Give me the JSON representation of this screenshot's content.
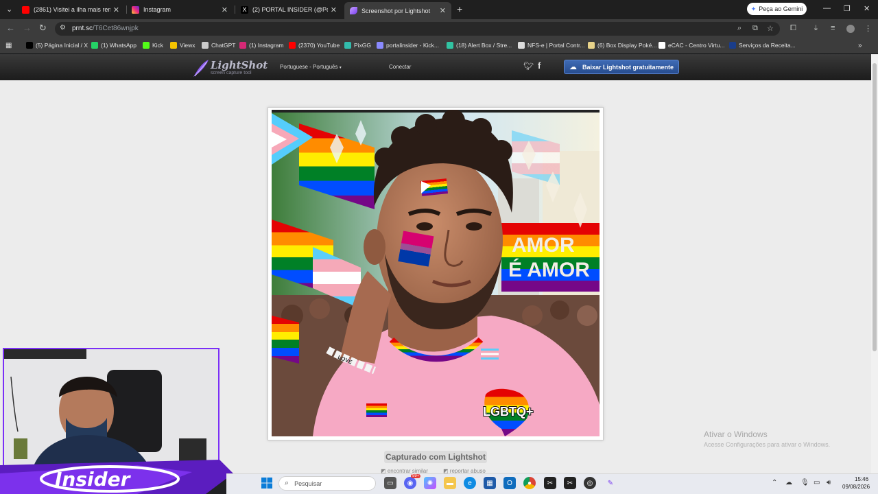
{
  "browser": {
    "tabs": [
      {
        "title": "(2861) Visitei a ilha mais remota",
        "favicon_color": "#ff0000",
        "active": false
      },
      {
        "title": "Instagram",
        "favicon_color": "#d62976",
        "active": false
      },
      {
        "title": "(2) PORTAL INSIDER (@Portal_I",
        "favicon_color": "#000000",
        "active": false
      },
      {
        "title": "Screenshot por Lightshot",
        "favicon_color": "#8a5cf5",
        "active": true
      }
    ],
    "gemini_button": "Peça ao Gemini",
    "url_host": "prnt.sc",
    "url_path": "/T6Cet86wnjpk",
    "bookmarks": [
      {
        "label": "(5) Página Inicial / X",
        "color": "#000000"
      },
      {
        "label": "(1) WhatsApp",
        "color": "#25d366"
      },
      {
        "label": "Kick",
        "color": "#53fc18"
      },
      {
        "label": "Viewx",
        "color": "#f5c400"
      },
      {
        "label": "ChatGPT",
        "color": "#cccccc"
      },
      {
        "label": "(1) Instagram",
        "color": "#d62976"
      },
      {
        "label": "(2370) YouTube",
        "color": "#ff0000"
      },
      {
        "label": "PixGG",
        "color": "#32bcad"
      },
      {
        "label": "portalinsider - Kick...",
        "color": "#8a8aff"
      },
      {
        "label": "(18) Alert Box / Stre...",
        "color": "#31c3a2"
      },
      {
        "label": "NFS-e | Portal Contr...",
        "color": "#dddddd"
      },
      {
        "label": "(6) Box Display Poké...",
        "color": "#e8d38a"
      },
      {
        "label": "eCAC - Centro Virtu...",
        "color": "#ffffff"
      },
      {
        "label": "Serviços da Receita...",
        "color": "#1a3d8a"
      }
    ]
  },
  "lightshot": {
    "logo_name": "LightShot",
    "logo_tagline": "screen capture tool",
    "language": "Portuguese - Português",
    "login": "Conectar",
    "download_button": "Baixar Lightshot gratuitamente",
    "captured_label": "Capturado com Lightshot",
    "find_similar": "encontrar similar",
    "report_abuse": "reportar abuso"
  },
  "screenshot_image": {
    "banner_text_line1": "AMOR",
    "banner_text_line2": "É AMOR",
    "bracelet_text": "LOVE",
    "badge_text": "LGBTQ+"
  },
  "overlay": {
    "brand": "Insider"
  },
  "windows": {
    "watermark_title": "Ativar o Windows",
    "watermark_sub": "Acesse Configurações para ativar o Windows.",
    "search_placeholder": "Pesquisar",
    "time": "15:46",
    "date": "09/08/2026",
    "notification_badge": "99+"
  }
}
